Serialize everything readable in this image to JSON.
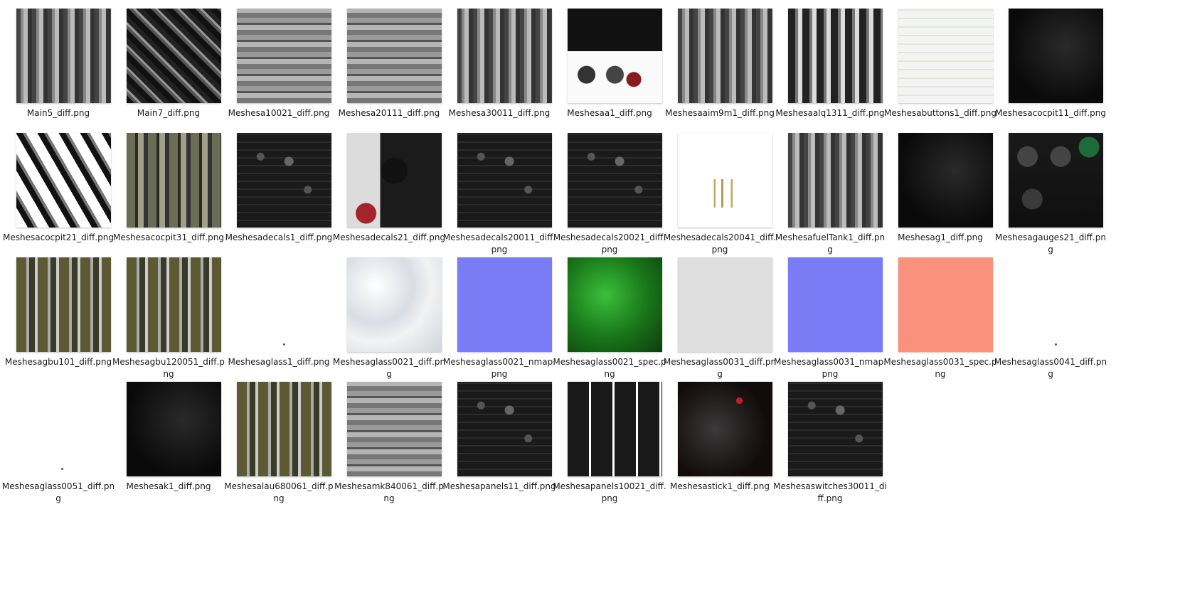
{
  "files": [
    {
      "name": "Main5_diff.png",
      "style": "metal"
    },
    {
      "name": "Main7_diff.png",
      "style": "metal-dark"
    },
    {
      "name": "Meshesa10021_diff.png",
      "style": "metal-light"
    },
    {
      "name": "Meshesa20111_diff.png",
      "style": "metal-light"
    },
    {
      "name": "Meshesa30011_diff.png",
      "style": "metal"
    },
    {
      "name": "Meshesaa1_diff.png",
      "style": "gauges-white"
    },
    {
      "name": "Meshesaaim9m1_diff.png",
      "style": "metal"
    },
    {
      "name": "Meshesaalq1311_diff.png",
      "style": "metal-white"
    },
    {
      "name": "Meshesabuttons1_diff.png",
      "style": "buttons-white"
    },
    {
      "name": "Meshesacocpit11_diff.png",
      "style": "black"
    },
    {
      "name": "Meshesacocpit21_diff.png",
      "style": "bw"
    },
    {
      "name": "Meshesacocpit31_diff.png",
      "style": "olive"
    },
    {
      "name": "Meshesadecals1_diff.png",
      "style": "black-panel"
    },
    {
      "name": "Meshesadecals21_diff.png",
      "style": "decals-mix"
    },
    {
      "name": "Meshesadecals20011_diff.png",
      "style": "black-panel"
    },
    {
      "name": "Meshesadecals20021_diff.png",
      "style": "black-panel"
    },
    {
      "name": "Meshesadecals20041_diff.png",
      "style": "white-decals"
    },
    {
      "name": "MeshesafuelTank1_diff.png",
      "style": "metal"
    },
    {
      "name": "Meshesag1_diff.png",
      "style": "black"
    },
    {
      "name": "Meshesagauges21_diff.png",
      "style": "gauges-black"
    },
    {
      "name": "Meshesagbu101_diff.png",
      "style": "olive-metal"
    },
    {
      "name": "Meshesagbu120051_diff.png",
      "style": "olive-metal"
    },
    {
      "name": "Meshesaglass1_diff.png",
      "style": "blank"
    },
    {
      "name": "Meshesaglass0021_diff.png",
      "style": "clouds"
    },
    {
      "name": "Meshesaglass0021_nmap.png",
      "style": "nmap"
    },
    {
      "name": "Meshesaglass0021_spec.png",
      "style": "green"
    },
    {
      "name": "Meshesaglass0031_diff.png",
      "style": "lightgray"
    },
    {
      "name": "Meshesaglass0031_nmap.png",
      "style": "nmap"
    },
    {
      "name": "Meshesaglass0031_spec.png",
      "style": "salmon"
    },
    {
      "name": "Meshesaglass0041_diff.png",
      "style": "blank"
    },
    {
      "name": "Meshesaglass0051_diff.png",
      "style": "blank"
    },
    {
      "name": "Meshesak1_diff.png",
      "style": "black"
    },
    {
      "name": "Meshesalau680061_diff.png",
      "style": "olive-metal"
    },
    {
      "name": "Meshesamk840061_diff.png",
      "style": "metal-light"
    },
    {
      "name": "Meshesapanels11_diff.png",
      "style": "black-panel"
    },
    {
      "name": "Meshesapanels10021_diff.png",
      "style": "panels-white"
    },
    {
      "name": "Meshesastick1_diff.png",
      "style": "dark-red"
    },
    {
      "name": "Meshesaswitches30011_diff.png",
      "style": "black-panel"
    }
  ],
  "colors": {
    "nmap": "#7a7cf6",
    "green": "#1a7a1a",
    "lightgray": "#dedede",
    "salmon": "#f9917c"
  }
}
